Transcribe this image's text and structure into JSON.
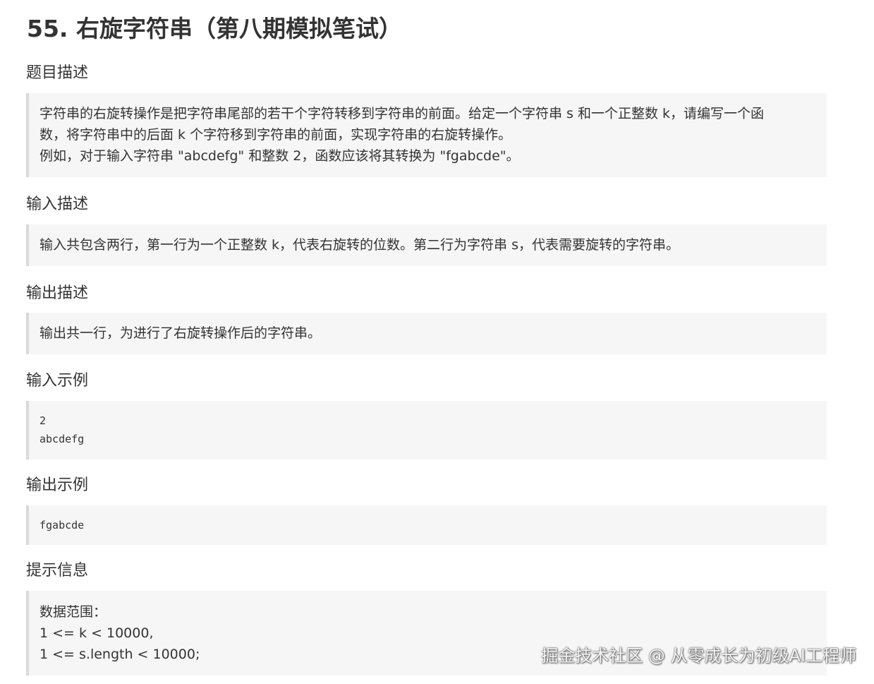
{
  "title": "55. 右旋字符串（第八期模拟笔试）",
  "sections": {
    "description": {
      "heading": "题目描述",
      "lines": [
        "字符串的右旋转操作是把字符串尾部的若干个字符转移到字符串的前面。给定一个字符串 s 和一个正整数 k，请编写一个函",
        "数，将字符串中的后面 k 个字符移到字符串的前面，实现字符串的右旋转操作。",
        "例如，对于输入字符串 \"abcdefg\" 和整数 2，函数应该将其转换为 \"fgabcde\"。"
      ]
    },
    "input_desc": {
      "heading": "输入描述",
      "lines": [
        "输入共包含两行，第一行为一个正整数 k，代表右旋转的位数。第二行为字符串 s，代表需要旋转的字符串。"
      ]
    },
    "output_desc": {
      "heading": "输出描述",
      "lines": [
        "输出共一行，为进行了右旋转操作后的字符串。"
      ]
    },
    "input_example": {
      "heading": "输入示例",
      "code": "2\nabcdefg"
    },
    "output_example": {
      "heading": "输出示例",
      "code": "fgabcde"
    },
    "hint": {
      "heading": "提示信息",
      "lines": [
        "数据范围：",
        "1 <= k < 10000,",
        "1 <= s.length < 10000;"
      ]
    }
  },
  "watermark": "掘金技术社区 @ 从零成长为初级AI工程师"
}
